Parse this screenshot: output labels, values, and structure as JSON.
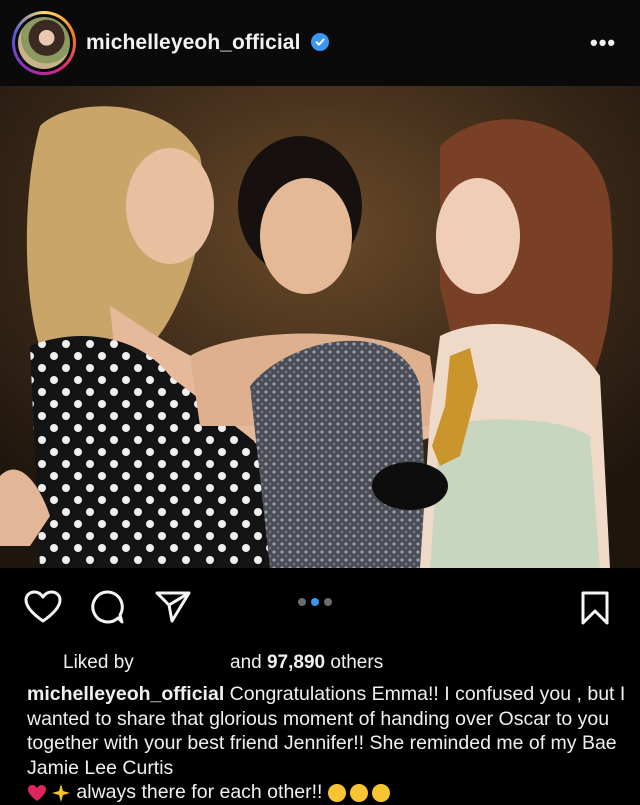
{
  "header": {
    "username": "michelleyeoh_official",
    "more_label": "•••"
  },
  "post": {
    "liked_by_label": "Liked by",
    "likes_count": "97,890",
    "likes_prefix": "and",
    "likes_suffix": "others",
    "caption_user": "michelleyeoh_official",
    "caption_text": "Congratulations Emma!! I confused you , but I wanted to share that glorious moment of handing over Oscar to you together with your best friend Jennifer!! She reminded me of my Bae Jamie Lee Curtis",
    "caption_tail": "always there for each other!!",
    "carousel_dots": 3,
    "carousel_active": 2
  },
  "icons": {
    "like": "heart-icon",
    "comment": "comment-icon",
    "share": "paper-plane-icon",
    "save": "bookmark-icon",
    "verified": "verified-badge-icon",
    "more": "more-icon"
  },
  "colors": {
    "verified": "#3897f0",
    "active_dot": "#3897f0",
    "background": "#000000"
  }
}
